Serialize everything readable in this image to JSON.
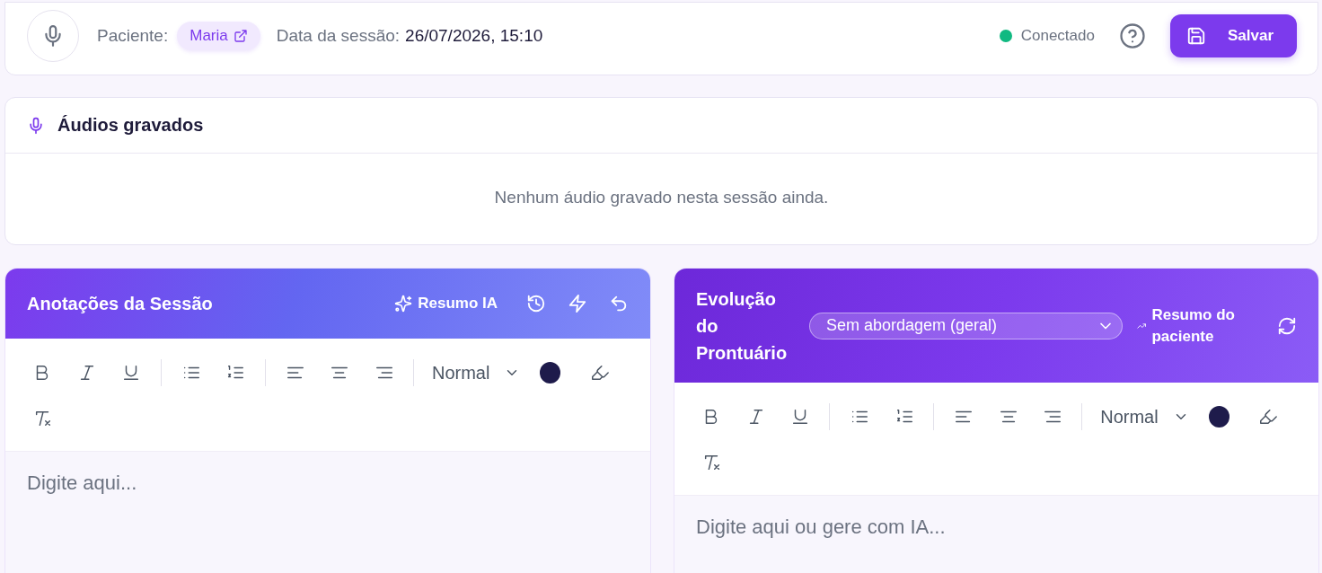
{
  "header": {
    "patient_label": "Paciente:",
    "patient_name": "Maria",
    "session_date_label": "Data da sessão:",
    "session_date": "26/07/2026, 15:10",
    "status": {
      "label": "Conectado",
      "color": "#10b981"
    },
    "save_button": "Salvar"
  },
  "recorded_audios": {
    "title": "Áudios gravados",
    "empty_message": "Nenhum áudio gravado nesta sessão ainda."
  },
  "editors": [
    {
      "title": "Anotações da Sessão",
      "kind": "notes",
      "actions": [
        {
          "kind": "sparkles",
          "label": "Resumo IA"
        },
        {
          "kind": "history"
        },
        {
          "kind": "lightning"
        },
        {
          "kind": "undo"
        }
      ],
      "font_size": "Normal",
      "placeholder": "Digite aqui..."
    },
    {
      "title": "Evolução do Prontuário",
      "kind": "record",
      "approach_select": "Sem abordagem (geral)",
      "actions": [
        {
          "kind": "trend",
          "label": "Resumo do paciente"
        },
        {
          "kind": "refresh"
        }
      ],
      "font_size": "Normal",
      "placeholder": "Digite aqui ou gere com IA..."
    }
  ]
}
